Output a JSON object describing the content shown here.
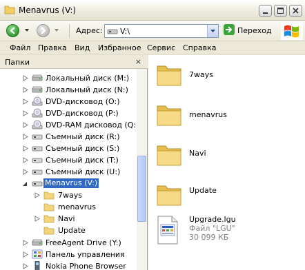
{
  "window": {
    "title": "Menavrus (V:)"
  },
  "toolbar": {
    "address_label": "Адрес:",
    "address_value": "V:\\",
    "go_label": "Переход"
  },
  "menu": [
    {
      "label": "Файл"
    },
    {
      "label": "Правка"
    },
    {
      "label": "Вид"
    },
    {
      "label": "Избранное"
    },
    {
      "label": "Сервис"
    },
    {
      "label": "Справка"
    }
  ],
  "folders_pane": {
    "title": "Папки",
    "close": "×",
    "tree": [
      {
        "label": "Локальный диск (M:)",
        "icon": "hard-drive-icon"
      },
      {
        "label": "Локальный диск (N:)",
        "icon": "hard-drive-icon"
      },
      {
        "label": "DVD-дисковод (O:)",
        "icon": "dvd-drive-icon"
      },
      {
        "label": "DVD-дисковод (P:)",
        "icon": "dvd-drive-icon"
      },
      {
        "label": "DVD-RAM дисковод (Q:)",
        "icon": "dvd-drive-icon"
      },
      {
        "label": "Съемный диск (R:)",
        "icon": "removable-drive-icon"
      },
      {
        "label": "Съемный диск (S:)",
        "icon": "removable-drive-icon"
      },
      {
        "label": "Съемный диск (T:)",
        "icon": "removable-drive-icon"
      },
      {
        "label": "Съемный диск (U:)",
        "icon": "removable-drive-icon"
      },
      {
        "label": "Menavrus (V:)",
        "icon": "removable-drive-icon",
        "selected": true
      },
      {
        "label": "7ways",
        "icon": "folder-icon"
      },
      {
        "label": "menavrus",
        "icon": "folder-icon"
      },
      {
        "label": "Navi",
        "icon": "folder-icon"
      },
      {
        "label": "Update",
        "icon": "folder-icon"
      },
      {
        "label": "FreeAgent Drive (Y:)",
        "icon": "hard-drive-icon"
      },
      {
        "label": "Панель управления",
        "icon": "control-panel-icon"
      },
      {
        "label": "Nokia Phone Browser",
        "icon": "phone-icon"
      }
    ]
  },
  "content": {
    "items": [
      {
        "name": "7ways",
        "type": "folder",
        "icon": "folder-icon"
      },
      {
        "name": "menavrus",
        "type": "folder",
        "icon": "folder-icon"
      },
      {
        "name": "Navi",
        "type": "folder",
        "icon": "folder-icon"
      },
      {
        "name": "Update",
        "type": "folder",
        "icon": "folder-icon"
      },
      {
        "name": "Upgrade.lgu",
        "type": "file",
        "icon": "file-icon",
        "filetype": "Файл \"LGU\"",
        "size": "30 099 КБ"
      }
    ]
  },
  "colors": {
    "selection": "#316ac5",
    "folder": "#f5d77a",
    "window_bg": "#ece9d8"
  }
}
